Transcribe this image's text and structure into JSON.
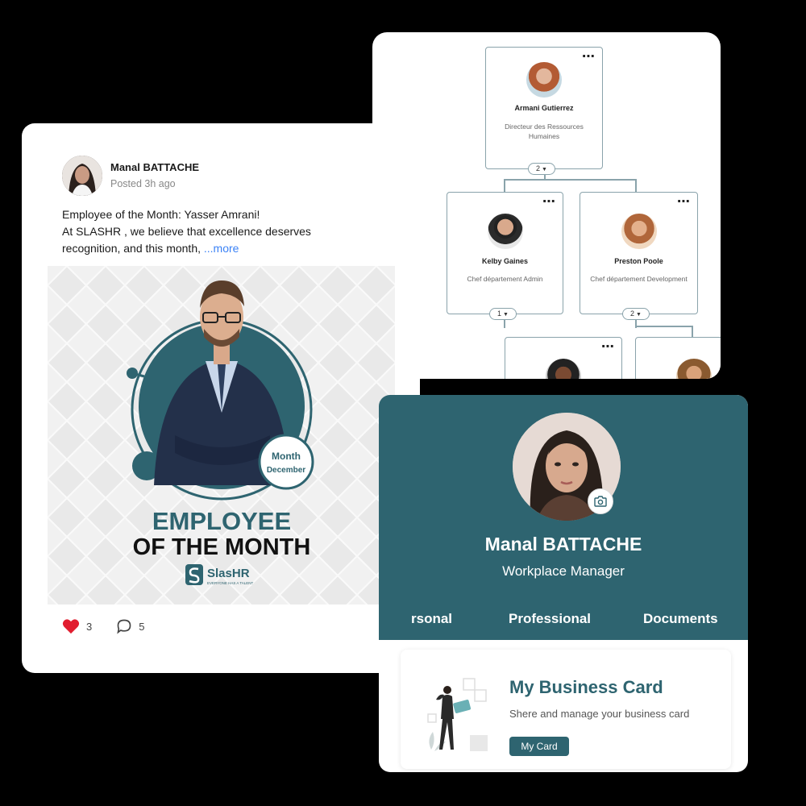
{
  "org_chart": {
    "nodes": [
      {
        "name": "Armani Gutierrez",
        "role": "Directeur des Ressources Humaines"
      },
      {
        "name": "Kelby Gaines",
        "role": "Chef département Admin"
      },
      {
        "name": "Preston Poole",
        "role": "Chef département Development"
      }
    ],
    "pills": [
      "2",
      "1",
      "2"
    ],
    "menu_icon": "⋯"
  },
  "post": {
    "author": "Manal BATTACHE",
    "time": "Posted 3h ago",
    "line1": "Employee of the Month: Yasser Amrani!",
    "line2": "At SLASHR , we believe that excellence deserves recognition, and this month, ",
    "more": "...more",
    "image": {
      "badge_month": "Month",
      "badge_sub": "December",
      "headline_1": "EMPLOYEE",
      "headline_2": "OF THE MONTH",
      "brand": "SlasHR",
      "brand_tagline": "EVERYONE HAS A TALENT"
    },
    "likes": "3",
    "comments": "5",
    "like_color": "#e11d2f"
  },
  "profile": {
    "name": "Manal BATTACHE",
    "title": "Workplace Manager",
    "tabs": [
      "rsonal",
      "Professional",
      "Documents"
    ],
    "accent": "#2e6470",
    "business_card": {
      "title": "My Business Card",
      "desc": "Shere and manage your business card",
      "button": "My Card"
    }
  }
}
